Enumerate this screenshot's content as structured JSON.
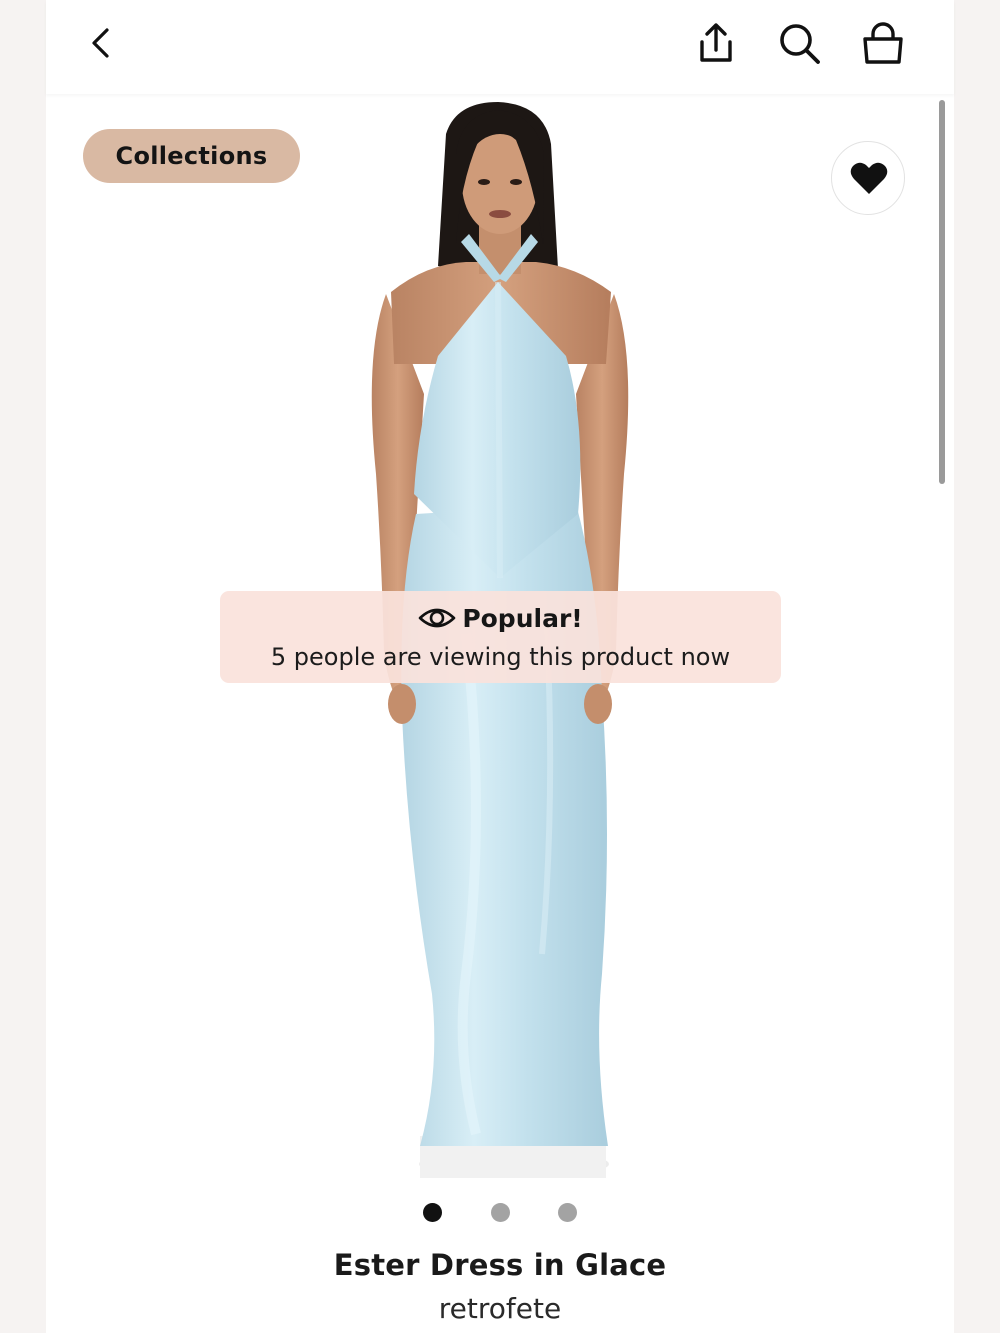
{
  "header": {
    "back_icon": "chevron-left-icon",
    "share_icon": "share-icon",
    "search_icon": "search-icon",
    "bag_icon": "shopping-bag-icon"
  },
  "gallery": {
    "collections_label": "Collections",
    "favorite_icon": "heart-icon",
    "popular": {
      "icon": "eye-icon",
      "title": "Popular!",
      "message": "5 people are viewing this product now"
    },
    "image_count": 3,
    "active_image": 1
  },
  "product": {
    "name": "Ester Dress in Glace",
    "brand": "retrofete"
  },
  "colors": {
    "chip_bg": "#d9b9a3",
    "banner_bg": "#fae2dc",
    "dress": "#c6e3ee",
    "text": "#1a1a1a"
  }
}
